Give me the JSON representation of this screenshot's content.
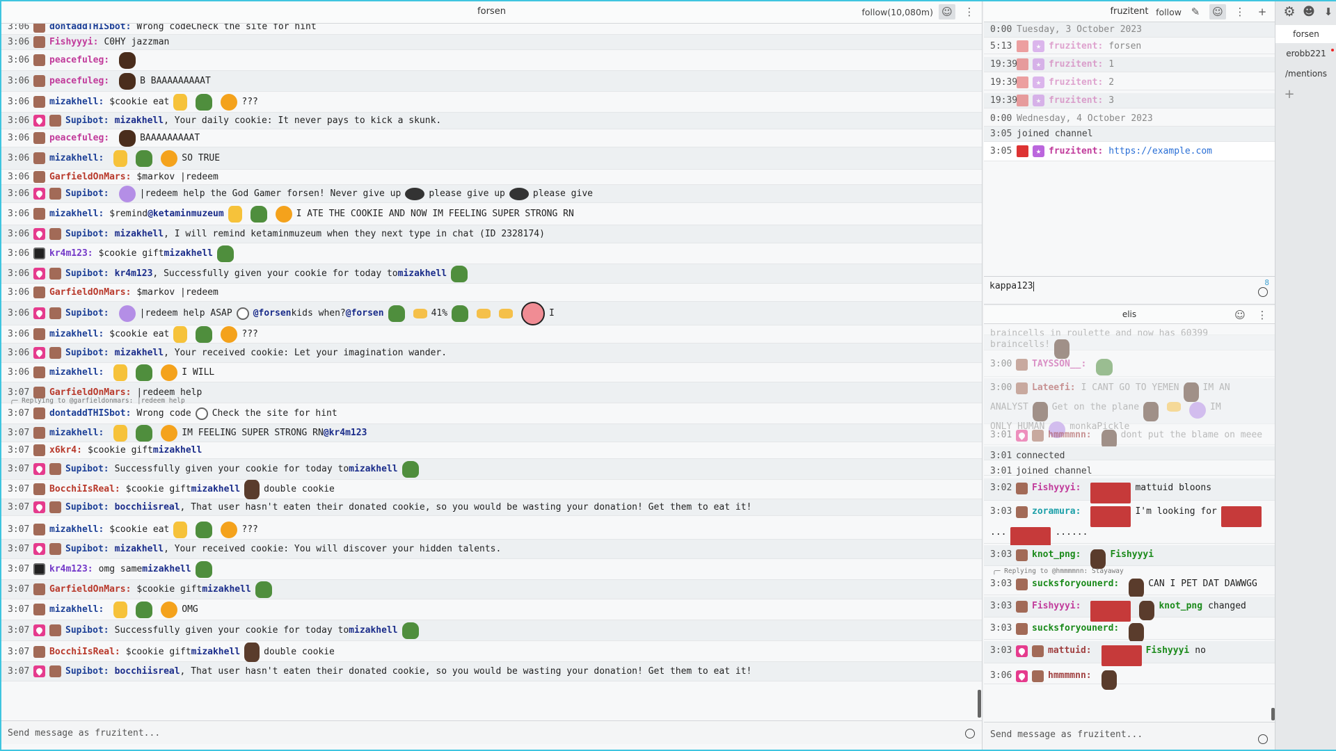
{
  "window": {
    "accent": "#3fc5df"
  },
  "left_split": {
    "title": "forsen",
    "follow_label": "follow(10,080m)",
    "input_placeholder": "Send message as fruzitent...",
    "messages": [
      {
        "time": "3:06",
        "user": "dontaddTHISbot:",
        "text": "Wrong code",
        "text2": "Check the site for hint"
      },
      {
        "time": "3:06",
        "user": "Fishyyyi:",
        "text": "C0HY jazzman"
      },
      {
        "time": "3:06",
        "user": "peacefuleg:",
        "text": ""
      },
      {
        "time": "3:06",
        "user": "peacefuleg:",
        "text": "B BAAAAAAAAAT"
      },
      {
        "time": "3:06",
        "user": "mizakhell:",
        "text": "$cookie eat",
        "text2": "???"
      },
      {
        "time": "3:06",
        "user": "Supibot:",
        "mention": "mizakhell",
        "text": ", Your daily cookie: It never pays to kick a skunk."
      },
      {
        "time": "3:06",
        "user": "peacefuleg:",
        "text": "BAAAAAAAAAT"
      },
      {
        "time": "3:06",
        "user": "mizakhell:",
        "text": "SO TRUE"
      },
      {
        "time": "3:06",
        "user": "GarfieldOnMars:",
        "text": "$markov |redeem"
      },
      {
        "time": "3:06",
        "user": "Supibot:",
        "text": "|redeem help the God Gamer forsen! Never give up",
        "text2": "please give up",
        "text3": "please give"
      },
      {
        "time": "3:06",
        "user": "mizakhell:",
        "text": "$remind",
        "mention": "@ketaminmuzeum",
        "text2": "I ATE THE COOKIE AND NOW IM FEELING SUPER STRONG RN"
      },
      {
        "time": "3:06",
        "user": "Supibot:",
        "mention": "mizakhell",
        "text": ", I will remind ketaminmuzeum when they next type in chat (ID 2328174)"
      },
      {
        "time": "3:06",
        "user": "kr4m123:",
        "text": "$cookie gift",
        "mention": "mizakhell"
      },
      {
        "time": "3:06",
        "user": "Supibot:",
        "mention": "kr4m123",
        "text": ", Successfully given your cookie for today to",
        "mention2": "mizakhell"
      },
      {
        "time": "3:06",
        "user": "GarfieldOnMars:",
        "text": "$markov |redeem"
      },
      {
        "time": "3:06",
        "user": "Supibot:",
        "text": "|redeem help ASAP",
        "mention": "@forsen",
        "text2": "kids when?",
        "mention2": "@forsen",
        "text3": "41%",
        "text4": "I"
      },
      {
        "time": "3:06",
        "user": "mizakhell:",
        "text": "$cookie eat",
        "text2": "???"
      },
      {
        "time": "3:06",
        "user": "Supibot:",
        "mention": "mizakhell",
        "text": ", Your received cookie: Let your imagination wander."
      },
      {
        "time": "3:06",
        "user": "mizakhell:",
        "text": "I WILL"
      },
      {
        "time": "3:07",
        "user": "GarfieldOnMars:",
        "text": "|redeem help"
      },
      {
        "time": "3:07",
        "user": "dontaddTHISbot:",
        "text": "Wrong code",
        "text2": "Check the site for hint",
        "reply": "Replying to @garfieldonmars: |redeem help"
      },
      {
        "time": "3:07",
        "user": "mizakhell:",
        "text": "IM FEELING SUPER STRONG RN",
        "mention": "@kr4m123"
      },
      {
        "time": "3:07",
        "user": "x6kr4:",
        "text": "$cookie gift",
        "mention": "mizakhell"
      },
      {
        "time": "3:07",
        "user": "Supibot:",
        "text": "Successfully given your cookie for today to",
        "mention": "mizakhell"
      },
      {
        "time": "3:07",
        "user": "BocchiIsReal:",
        "text": "$cookie gift",
        "mention": "mizakhell",
        "text2": "double cookie"
      },
      {
        "time": "3:07",
        "user": "Supibot:",
        "mention": "bocchiisreal",
        "text": ", That user hasn't eaten their donated cookie, so you would be wasting your donation! Get them to eat it!"
      },
      {
        "time": "3:07",
        "user": "mizakhell:",
        "text": "$cookie eat",
        "text2": "???"
      },
      {
        "time": "3:07",
        "user": "Supibot:",
        "mention": "mizakhell",
        "text": ", Your received cookie: You will discover your hidden talents."
      },
      {
        "time": "3:07",
        "user": "kr4m123:",
        "text": "omg same",
        "mention": "mizakhell"
      },
      {
        "time": "3:07",
        "user": "GarfieldOnMars:",
        "text": "$cookie gift",
        "mention": "mizakhell"
      },
      {
        "time": "3:07",
        "user": "mizakhell:",
        "text": "OMG"
      },
      {
        "time": "3:07",
        "user": "Supibot:",
        "text": "Successfully given your cookie for today to",
        "mention": "mizakhell"
      },
      {
        "time": "3:07",
        "user": "BocchiIsReal:",
        "text": "$cookie gift",
        "mention": "mizakhell",
        "text2": "double cookie"
      },
      {
        "time": "3:07",
        "user": "Supibot:",
        "mention": "bocchiisreal",
        "text": ", That user hasn't eaten their donated cookie, so you would be wasting your donation! Get them to eat it!"
      }
    ]
  },
  "top_right_split": {
    "title": "fruzitent",
    "follow_label": "follow",
    "input_value": "kappa123",
    "char_count": "8",
    "messages": [
      {
        "time": "0:00",
        "text": "Tuesday, 3 October 2023"
      },
      {
        "time": "5:13",
        "user": "fruzitent:",
        "text": "forsen"
      },
      {
        "time": "19:39",
        "user": "fruzitent:",
        "text": "1"
      },
      {
        "time": "19:39",
        "user": "fruzitent:",
        "text": "2"
      },
      {
        "time": "19:39",
        "user": "fruzitent:",
        "text": "3"
      },
      {
        "time": "0:00",
        "text": "Wednesday, 4 October 2023"
      },
      {
        "time": "3:05",
        "text": "joined channel"
      },
      {
        "time": "3:05",
        "user": "fruzitent:",
        "text": "https://example.com"
      }
    ]
  },
  "bottom_right_split": {
    "title": "elis",
    "input_placeholder": "Send message as fruzitent...",
    "messages": [
      {
        "time": "",
        "text": "braincells in roulette and now has 60399"
      },
      {
        "time": "",
        "text": "braincells!"
      },
      {
        "time": "3:00",
        "user": "TAYSSON__:",
        "text": ""
      },
      {
        "time": "3:00",
        "user": "Lateefi:",
        "text": "I CANT GO TO YEMEN",
        "text2": "IM AN",
        "line2": "ANALYST",
        "line2b": "Get on the plane",
        "line2c": "IM",
        "line3": "ONLY HUMAN",
        "line3b": "monkaPickle"
      },
      {
        "time": "3:01",
        "user": "hmmmmnn:",
        "text": "dont put the blame on meee"
      },
      {
        "time": "3:01",
        "text": "connected"
      },
      {
        "time": "3:01",
        "text": "joined channel"
      },
      {
        "time": "3:02",
        "user": "Fishyyyi:",
        "text": "mattuid bloons"
      },
      {
        "time": "3:03",
        "user": "zoramura:",
        "text": "I'm looking for",
        "line2": "...",
        "line2b": "......"
      },
      {
        "time": "3:03",
        "user": "knot_png:",
        "mention": "Fishyyyi"
      },
      {
        "time": "3:03",
        "user": "sucksforyounerd:",
        "text": "CAN I PET DAT DAWWGG",
        "reply": "Replying to @hmmmmnn: Stayaway"
      },
      {
        "time": "3:03",
        "user": "Fishyyyi:",
        "mention": "knot_png",
        "text": "changed"
      },
      {
        "time": "3:03",
        "user": "sucksforyounerd:",
        "text": ""
      },
      {
        "time": "3:03",
        "user": "mattuid:",
        "mention": "Fishyyyi",
        "text": "no"
      },
      {
        "time": "3:06",
        "user": "hmmmmnn:",
        "text": ""
      }
    ]
  },
  "tabs": [
    {
      "label": "forsen"
    },
    {
      "label": "erobb221"
    },
    {
      "label": "/mentions"
    }
  ]
}
